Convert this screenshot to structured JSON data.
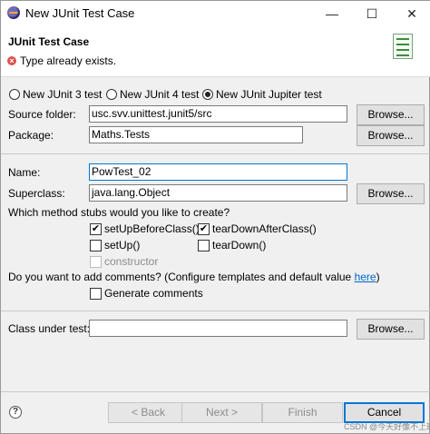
{
  "window": {
    "title": "New JUnit Test Case",
    "minimize_glyph": "—",
    "maximize_glyph": "☐",
    "close_glyph": "✕"
  },
  "header": {
    "title": "JUnit Test Case",
    "message": "Type already exists.",
    "message_icon": "error-icon"
  },
  "junit_versions": [
    {
      "label": "New JUnit 3 test",
      "selected": false
    },
    {
      "label": "New JUnit 4 test",
      "selected": false
    },
    {
      "label": "New JUnit Jupiter test",
      "selected": true
    }
  ],
  "source_folder": {
    "label": "Source folder:",
    "value": "usc.svv.unittest.junit5/src",
    "button": "Browse..."
  },
  "package": {
    "label": "Package:",
    "value": "Maths.Tests",
    "button": "Browse..."
  },
  "name": {
    "label": "Name:",
    "value": "PowTest_02"
  },
  "superclass": {
    "label": "Superclass:",
    "value": "java.lang.Object",
    "button": "Browse..."
  },
  "method_stubs": {
    "question": "Which method stubs would you like to create?",
    "options": [
      {
        "label": "setUpBeforeClass()",
        "checked": true,
        "enabled": true
      },
      {
        "label": "tearDownAfterClass()",
        "checked": true,
        "enabled": true
      },
      {
        "label": "setUp()",
        "checked": false,
        "enabled": true
      },
      {
        "label": "tearDown()",
        "checked": false,
        "enabled": true
      },
      {
        "label": "constructor",
        "checked": false,
        "enabled": false
      }
    ]
  },
  "comments": {
    "question": "Do you want to add comments? (Configure templates and default value ",
    "link": "here",
    "question_end": ")",
    "option": {
      "label": "Generate comments",
      "checked": false
    }
  },
  "class_under_test": {
    "label": "Class under test:",
    "value": "",
    "button": "Browse..."
  },
  "footer": {
    "help_glyph": "?",
    "back": "< Back",
    "next": "Next >",
    "finish": "Finish",
    "cancel": "Cancel"
  },
  "watermark": "CSDN @今天好像不上班",
  "colors": {
    "focus": "#0078d7",
    "error": "#d9534f",
    "link": "#0066cc"
  }
}
